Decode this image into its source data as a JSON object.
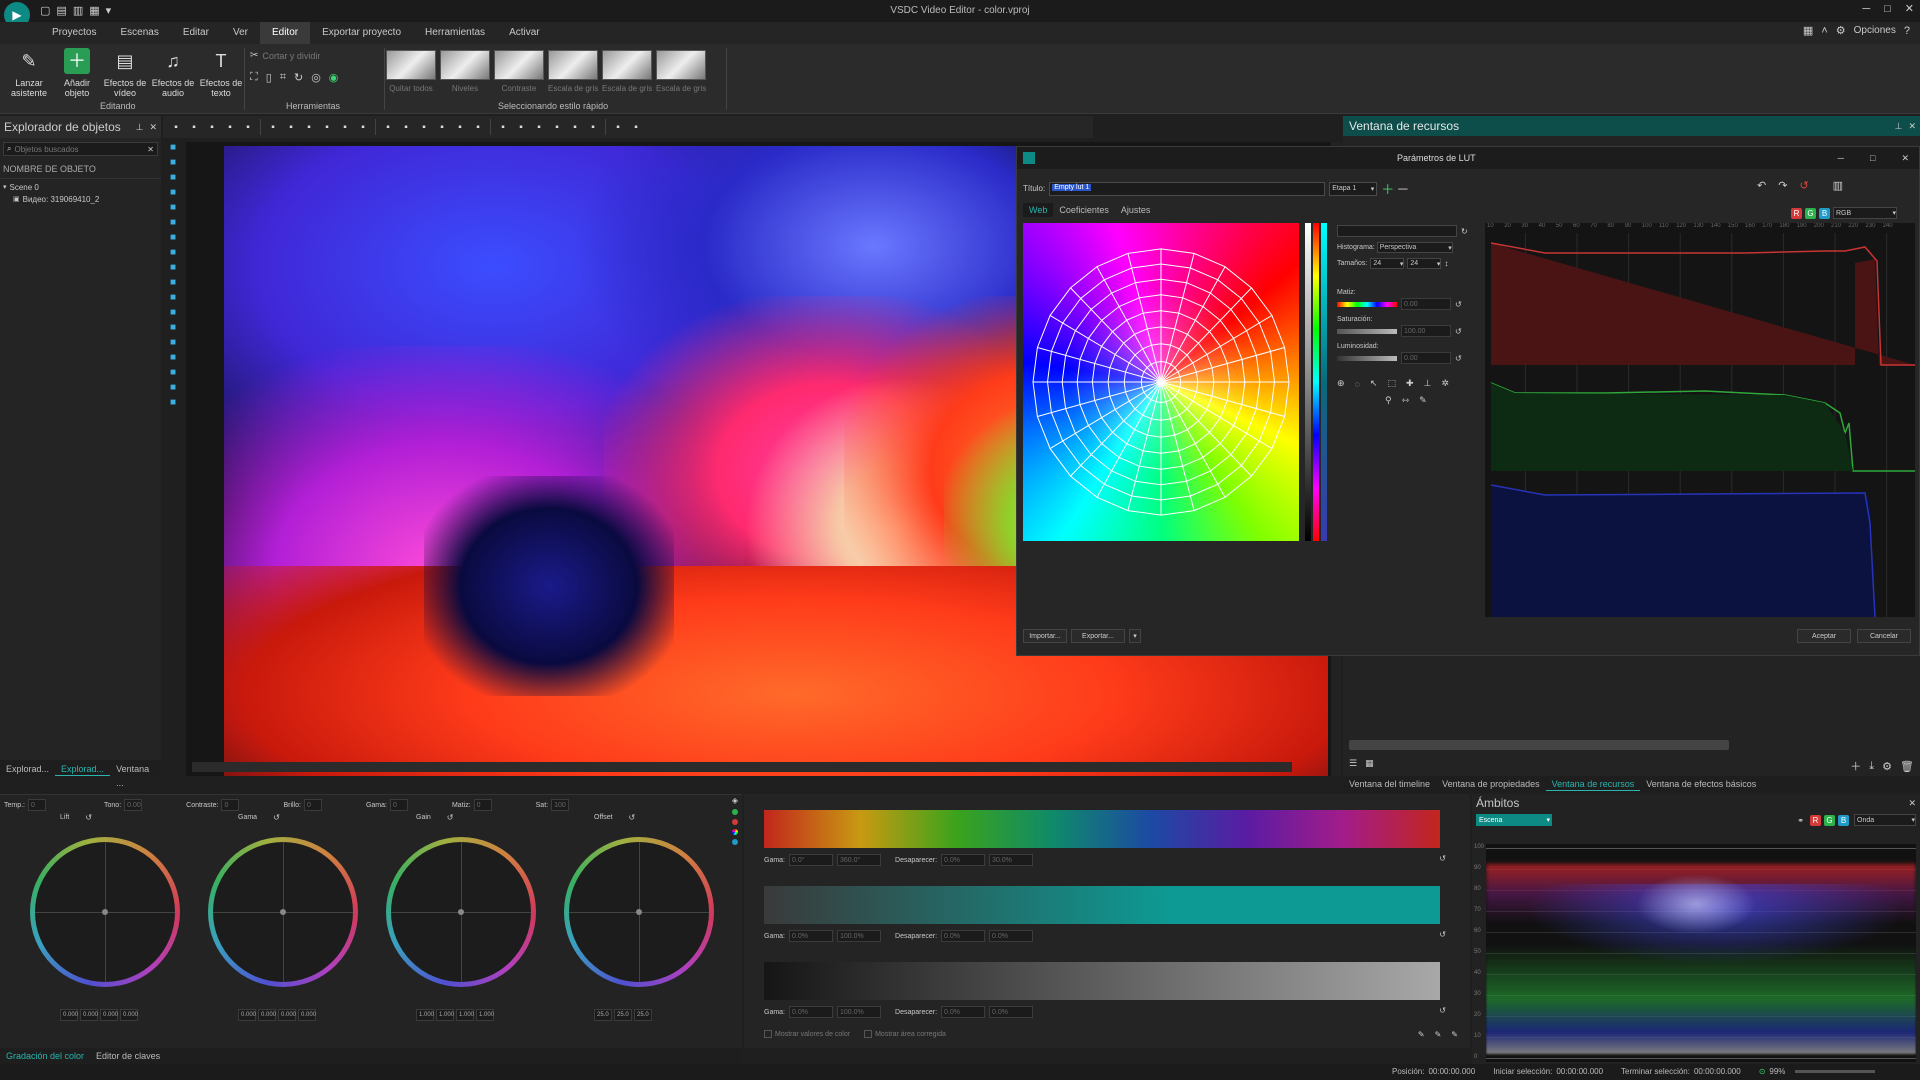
{
  "window": {
    "title": "VSDC Video Editor - color.vproj",
    "options_label": "Opciones"
  },
  "menu": {
    "items": [
      "Proyectos",
      "Escenas",
      "Editar",
      "Ver",
      "Editor",
      "Exportar proyecto",
      "Herramientas",
      "Activar"
    ],
    "active_index": 4
  },
  "ribbon": {
    "editing": {
      "buttons": [
        {
          "label": "Lanzar asistente",
          "icon": "wand-icon"
        },
        {
          "label": "Añadir objeto",
          "icon": "add-object-icon"
        },
        {
          "label": "Efectos de vídeo",
          "icon": "video-effects-icon"
        },
        {
          "label": "Efectos de audio",
          "icon": "audio-effects-icon"
        },
        {
          "label": "Efectos de texto",
          "icon": "text-effects-icon"
        }
      ],
      "group_label": "Editando"
    },
    "tools": {
      "cut_label": "Cortar y dividir",
      "group_label": "Herramientas"
    },
    "quick_style": {
      "items": [
        "Quitar todos",
        "Niveles",
        "Contraste",
        "Escala de gris",
        "Escala de gris",
        "Escala de gris"
      ],
      "group_label": "Seleccionando estilo rápido"
    }
  },
  "object_explorer": {
    "title": "Explorador de objetos",
    "search_placeholder": "Objetos buscados",
    "column_header": "NOMBRE DE OBJETO",
    "tree": [
      {
        "label": "Scene 0"
      },
      {
        "label": "Видео: 319069410_2"
      }
    ],
    "bottom_tabs": [
      "Explorad...",
      "Explorad...",
      "Ventana ..."
    ]
  },
  "resource_window": {
    "title": "Ventana de recursos",
    "bottom_tabs": [
      "Ventana del timeline",
      "Ventana de propiedades",
      "Ventana de recursos",
      "Ventana de efectos básicos"
    ],
    "active_tab_index": 2
  },
  "lut_dialog": {
    "title": "Parámetros de LUT",
    "title_label": "Título:",
    "title_value": "Empty lut 1",
    "stage_value": "Etapa 1",
    "tabs": [
      "Web",
      "Coeficientes",
      "Ajustes"
    ],
    "active_tab_index": 0,
    "histogram_label": "Histograma:",
    "histogram_value": "Perspectiva",
    "sizes_label": "Tamaños:",
    "size_a": "24",
    "size_b": "24",
    "hue_label": "Matiz:",
    "hue_value": "0.00",
    "saturation_label": "Saturación:",
    "saturation_value": "100.00",
    "luminosity_label": "Luminosidad:",
    "luminosity_value": "0.00",
    "import_label": "Importar...",
    "export_label": "Exportar...",
    "accept_label": "Aceptar",
    "cancel_label": "Cancelar",
    "channel_chips": [
      "R",
      "G",
      "B"
    ],
    "channel_mode": "RGB",
    "histogram_ruler": [
      "10",
      "20",
      "30",
      "40",
      "50",
      "60",
      "70",
      "80",
      "90",
      "100",
      "110",
      "120",
      "130",
      "140",
      "150",
      "160",
      "170",
      "180",
      "190",
      "200",
      "210",
      "220",
      "230",
      "240"
    ],
    "colors": {
      "red": "#d43a3a",
      "green": "#2bb24c",
      "blue": "#1f9ac9",
      "accent": "#0e8a85"
    }
  },
  "color_grading": {
    "params": [
      {
        "label": "Temp.:",
        "value": "0"
      },
      {
        "label": "Tono:",
        "value": "0.00"
      },
      {
        "label": "Contraste:",
        "value": "0"
      },
      {
        "label": "Brillo:",
        "value": "0"
      },
      {
        "label": "Gama:",
        "value": "0"
      },
      {
        "label": "Matiz:",
        "value": "0"
      },
      {
        "label": "Sat:",
        "value": "100"
      }
    ],
    "wheels": [
      {
        "label": "Lift",
        "values": [
          "0.000",
          "0.000",
          "0.000",
          "0.000"
        ]
      },
      {
        "label": "Gama",
        "values": [
          "0.000",
          "0.000",
          "0.000",
          "0.000"
        ]
      },
      {
        "label": "Gain",
        "values": [
          "1.000",
          "1.000",
          "1.000",
          "1.000"
        ]
      },
      {
        "label": "Offset",
        "values": [
          "25.0",
          "25.0",
          "25.0"
        ]
      }
    ],
    "bottom_tabs": [
      "Gradación del color",
      "Editor de claves"
    ]
  },
  "gradient_bars": {
    "rows": [
      {
        "gama_label": "Gama:",
        "a": "0.0°",
        "b": "360.0°",
        "fade_label": "Desaparecer:",
        "c": "0.0%",
        "d": "30.0%"
      },
      {
        "gama_label": "Gama:",
        "a": "0.0%",
        "b": "100.0%",
        "fade_label": "Desaparecer:",
        "c": "0.0%",
        "d": "0.0%"
      },
      {
        "gama_label": "Gama:",
        "a": "0.0%",
        "b": "100.0%",
        "fade_label": "Desaparecer:",
        "c": "0.0%",
        "d": "0.0%"
      }
    ],
    "show_values_label": "Mostrar valores de color",
    "show_area_label": "Mostrar área corregida"
  },
  "scopes": {
    "title": "Ámbitos",
    "scene_value": "Escena",
    "mode_value": "Onda",
    "axis": [
      "100",
      "90",
      "80",
      "70",
      "60",
      "50",
      "40",
      "30",
      "20",
      "10",
      "0"
    ]
  },
  "status": {
    "position_label": "Posición:",
    "position_value": "00:00:00.000",
    "start_label": "Iniciar selección:",
    "start_value": "00:00:00.000",
    "end_label": "Terminar selección:",
    "end_value": "00:00:00.000",
    "zoom_value": "99%"
  }
}
